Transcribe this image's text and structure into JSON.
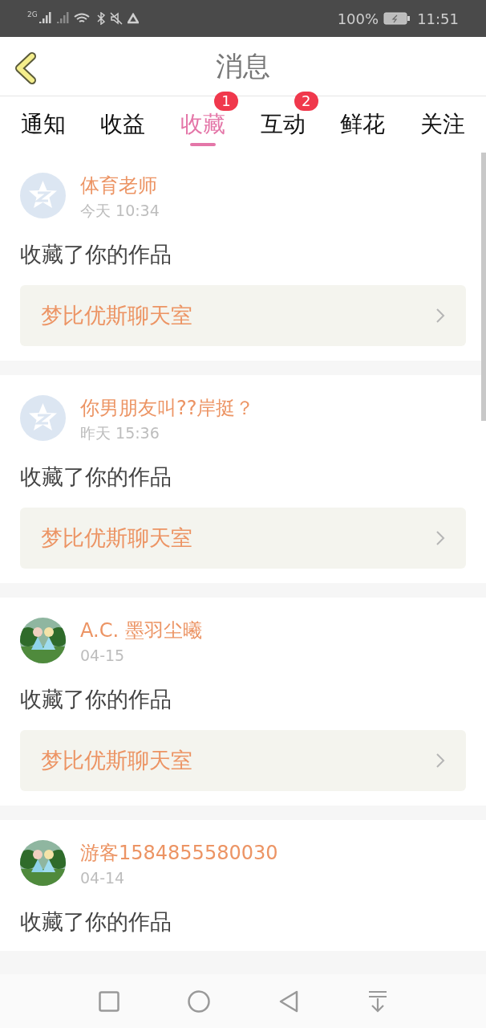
{
  "status_bar": {
    "network": "2G",
    "battery": "100%",
    "time": "11:51"
  },
  "header": {
    "title": "消息"
  },
  "tabs": [
    {
      "label": "通知",
      "selected": false
    },
    {
      "label": "收益",
      "selected": false
    },
    {
      "label": "收藏",
      "selected": true,
      "badge": "1"
    },
    {
      "label": "互动",
      "selected": false,
      "badge": "2"
    },
    {
      "label": "鲜花",
      "selected": false
    },
    {
      "label": "关注",
      "selected": false
    }
  ],
  "messages": [
    {
      "default_avatar": true,
      "name": "体育老师",
      "time": "今天 10:34",
      "action": "收藏了你的作品",
      "link": "梦比优斯聊天室"
    },
    {
      "default_avatar": true,
      "name": "你男朋友叫??岸挺？",
      "time": "昨天 15:36",
      "action": "收藏了你的作品",
      "link": "梦比优斯聊天室"
    },
    {
      "default_avatar": false,
      "name": "A.C. 墨羽尘曦",
      "time": "04-15",
      "action": "收藏了你的作品",
      "link": "梦比优斯聊天室"
    },
    {
      "default_avatar": false,
      "name": "游客1584855580030",
      "time": "04-14",
      "action": "收藏了你的作品"
    }
  ]
}
